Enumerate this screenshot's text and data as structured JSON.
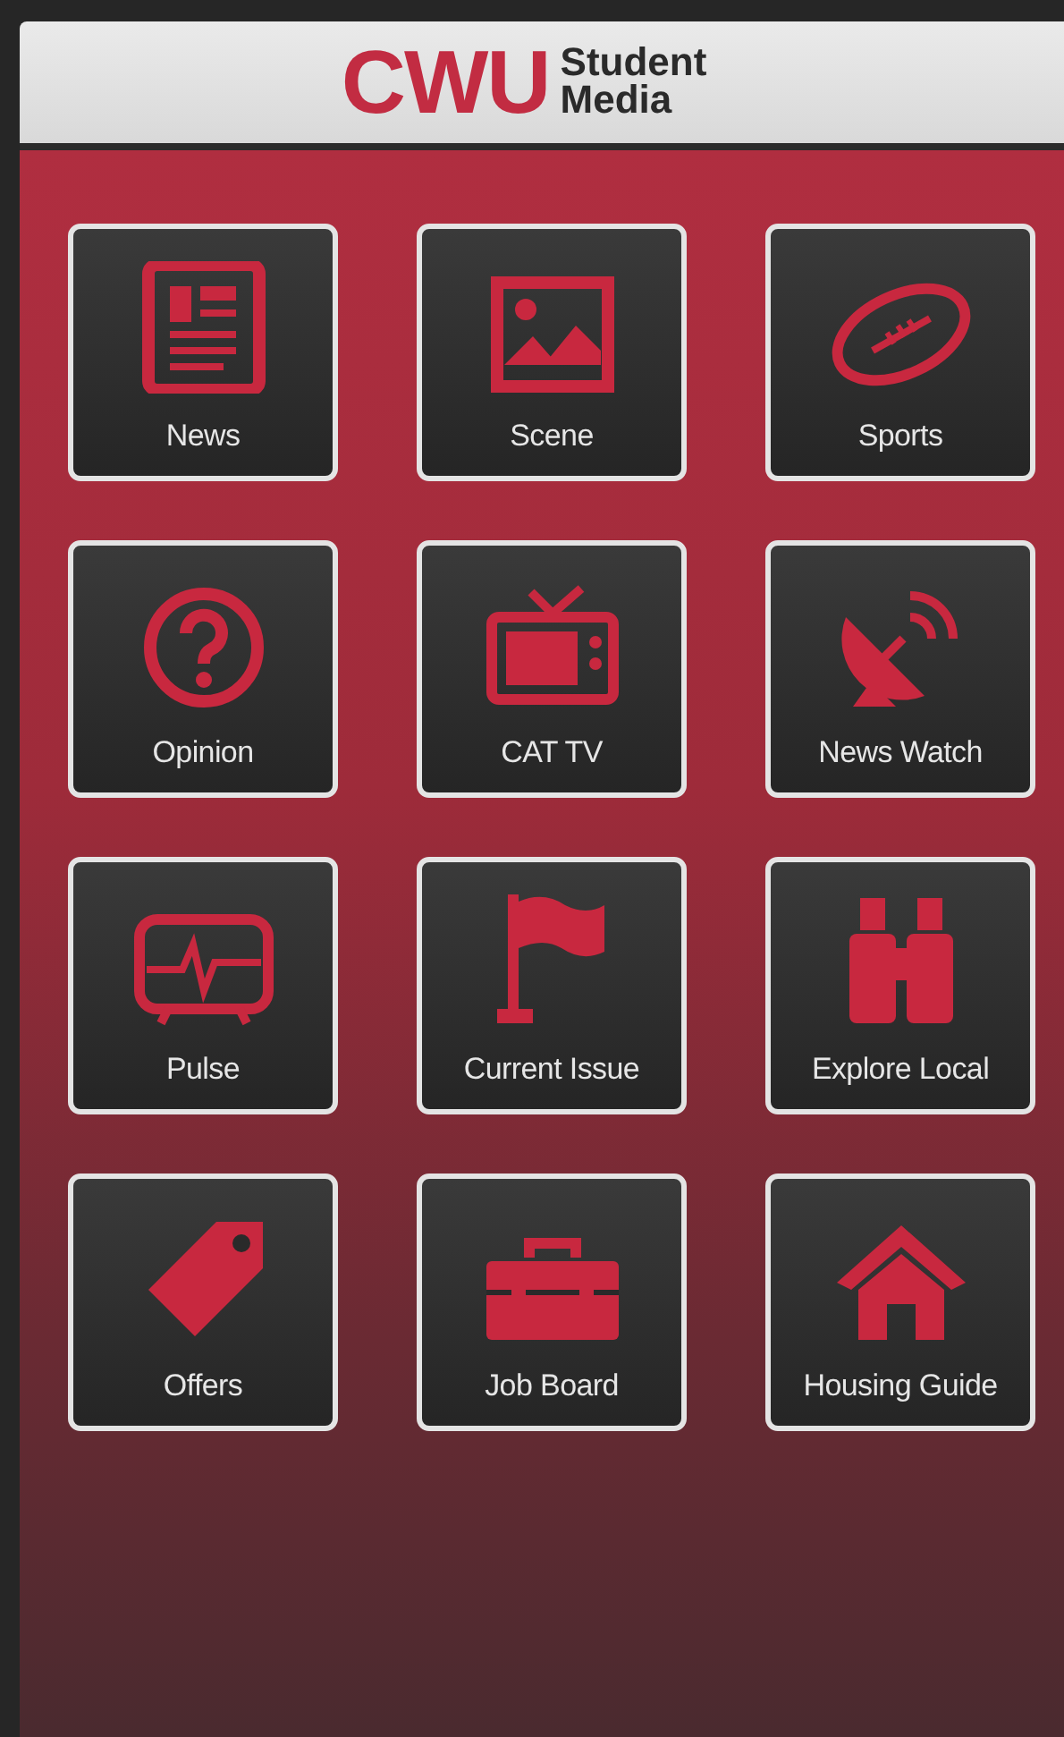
{
  "header": {
    "logo": "CWU",
    "subtitle_line_1": "Student",
    "subtitle_line_2": "Media"
  },
  "tiles": [
    {
      "label": "News"
    },
    {
      "label": "Scene"
    },
    {
      "label": "Sports"
    },
    {
      "label": "Opinion"
    },
    {
      "label": "CAT TV"
    },
    {
      "label": "News Watch"
    },
    {
      "label": "Pulse"
    },
    {
      "label": "Current Issue"
    },
    {
      "label": "Explore Local"
    },
    {
      "label": "Offers"
    },
    {
      "label": "Job Board"
    },
    {
      "label": "Housing Guide"
    }
  ]
}
